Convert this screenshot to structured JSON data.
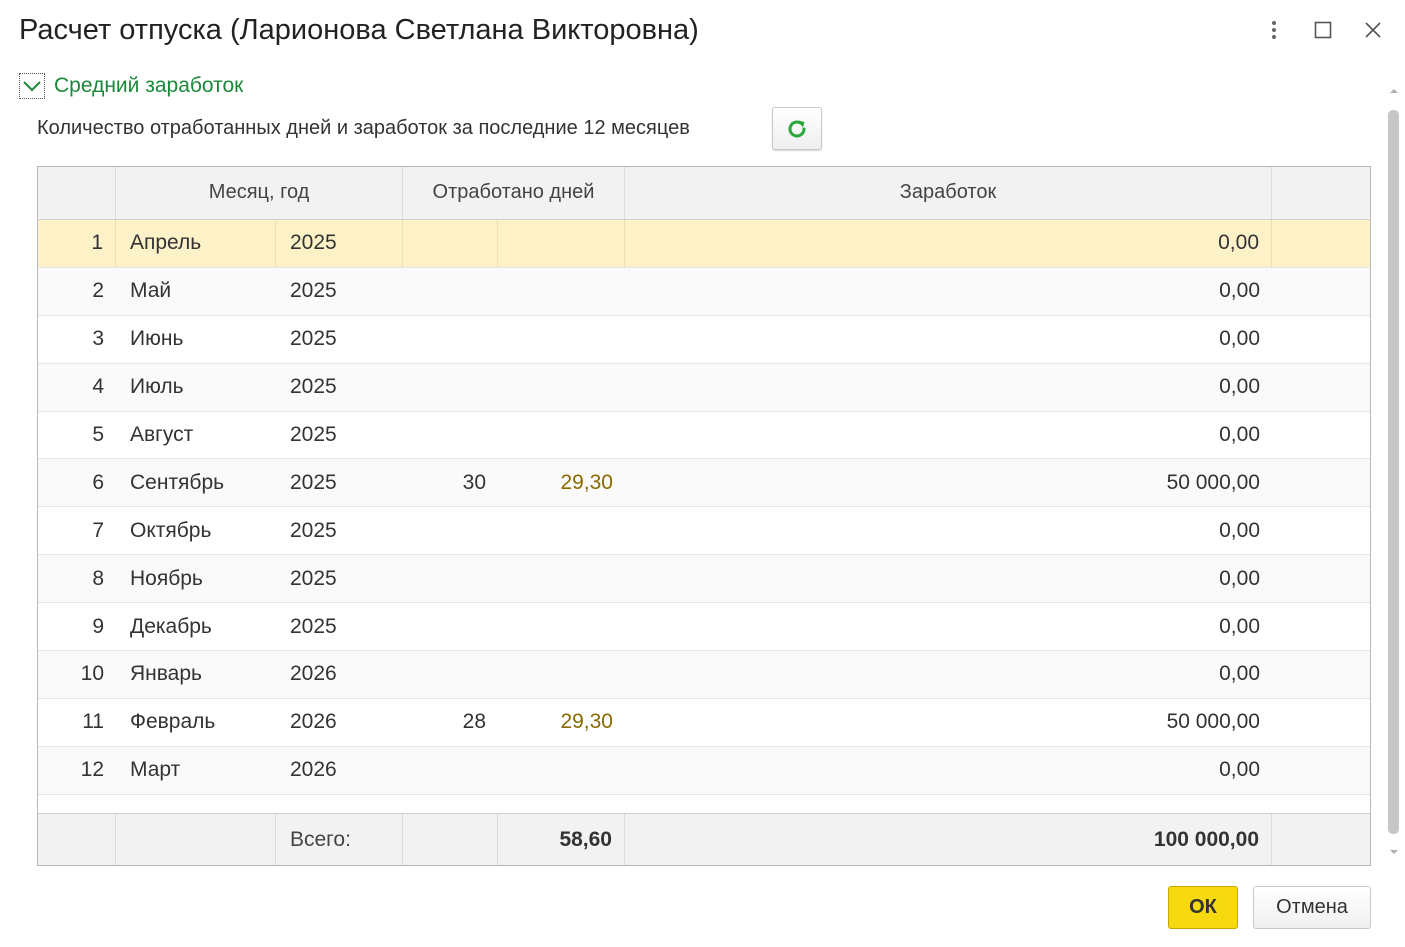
{
  "window": {
    "title": "Расчет отпуска (Ларионова Светлана Викторовна)"
  },
  "group": {
    "title": "Средний заработок",
    "subtitle": "Количество отработанных дней и заработок за последние 12 месяцев"
  },
  "table": {
    "headers": {
      "month_year": "Месяц, год",
      "worked_days": "Отработано дней",
      "earnings": "Заработок"
    },
    "rows": [
      {
        "n": "1",
        "month": "Апрель",
        "year": "2025",
        "days": "",
        "days_calc": "",
        "earnings": "0,00"
      },
      {
        "n": "2",
        "month": "Май",
        "year": "2025",
        "days": "",
        "days_calc": "",
        "earnings": "0,00"
      },
      {
        "n": "3",
        "month": "Июнь",
        "year": "2025",
        "days": "",
        "days_calc": "",
        "earnings": "0,00"
      },
      {
        "n": "4",
        "month": "Июль",
        "year": "2025",
        "days": "",
        "days_calc": "",
        "earnings": "0,00"
      },
      {
        "n": "5",
        "month": "Август",
        "year": "2025",
        "days": "",
        "days_calc": "",
        "earnings": "0,00"
      },
      {
        "n": "6",
        "month": "Сентябрь",
        "year": "2025",
        "days": "30",
        "days_calc": "29,30",
        "earnings": "50 000,00"
      },
      {
        "n": "7",
        "month": "Октябрь",
        "year": "2025",
        "days": "",
        "days_calc": "",
        "earnings": "0,00"
      },
      {
        "n": "8",
        "month": "Ноябрь",
        "year": "2025",
        "days": "",
        "days_calc": "",
        "earnings": "0,00"
      },
      {
        "n": "9",
        "month": "Декабрь",
        "year": "2025",
        "days": "",
        "days_calc": "",
        "earnings": "0,00"
      },
      {
        "n": "10",
        "month": "Январь",
        "year": "2026",
        "days": "",
        "days_calc": "",
        "earnings": "0,00"
      },
      {
        "n": "11",
        "month": "Февраль",
        "year": "2026",
        "days": "28",
        "days_calc": "29,30",
        "earnings": "50 000,00"
      },
      {
        "n": "12",
        "month": "Март",
        "year": "2026",
        "days": "",
        "days_calc": "",
        "earnings": "0,00"
      }
    ],
    "footer": {
      "label": "Всего:",
      "days_total": "58,60",
      "earnings_total": "100 000,00"
    }
  },
  "buttons": {
    "ok": "ОК",
    "cancel": "Отмена"
  },
  "colors": {
    "accent_green": "#1a8a3a",
    "selected_row": "#fdf1c8",
    "ok_button": "#f7d90f",
    "calc_days_text": "#8a6a00"
  },
  "icons": {
    "more": "more-vertical-icon",
    "maximize": "maximize-icon",
    "close": "close-icon",
    "collapse": "chevron-down-icon",
    "refresh": "refresh-icon"
  }
}
